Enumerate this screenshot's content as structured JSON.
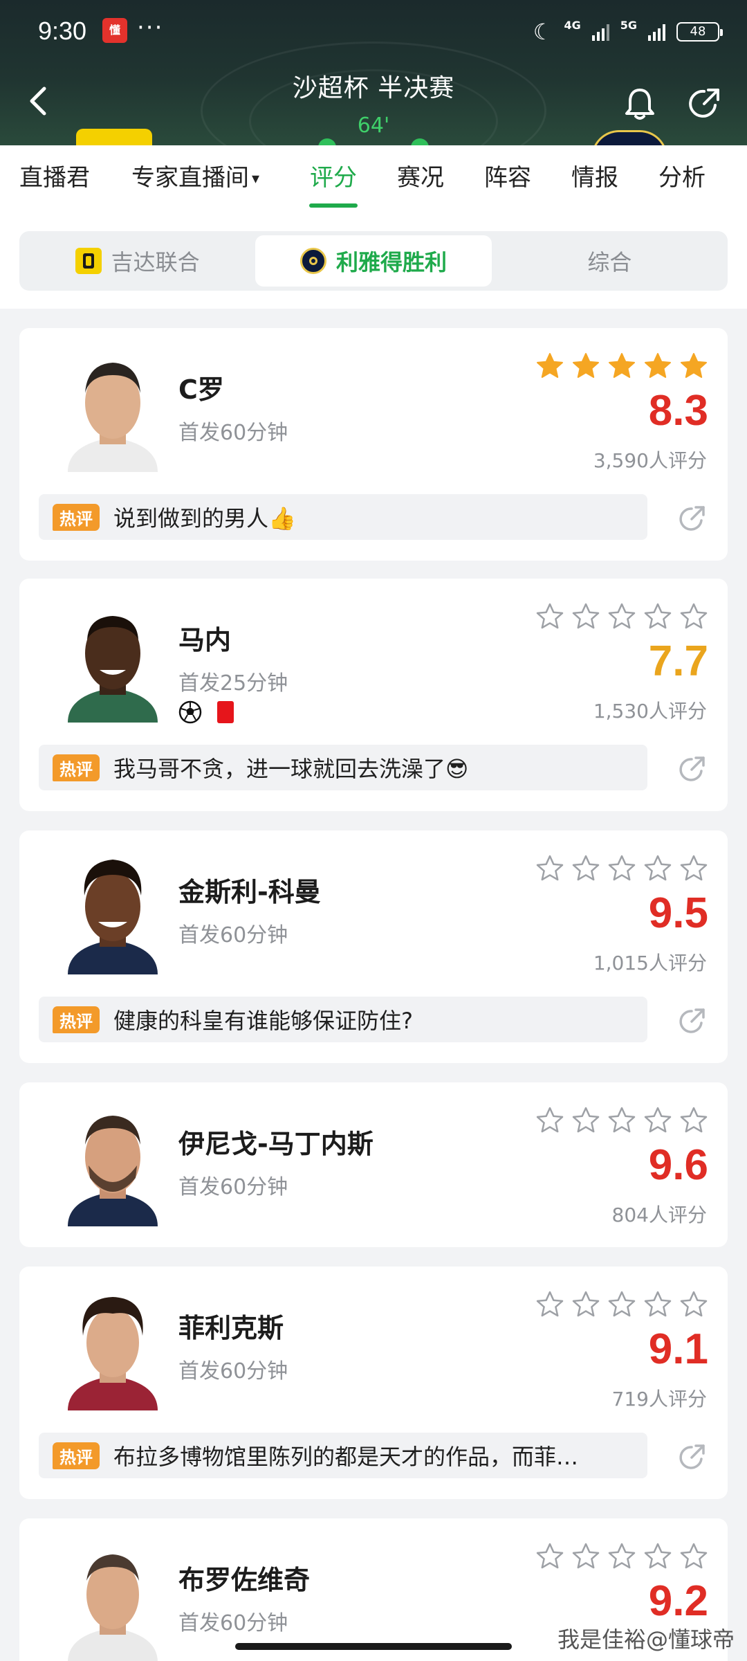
{
  "status": {
    "time": "9:30",
    "app_icon_text": "懂",
    "dots": "···",
    "net1": "4G",
    "net2": "5G",
    "battery": "48"
  },
  "header": {
    "title": "沙超杯 半决赛",
    "minute": "64'"
  },
  "tabs": [
    {
      "label": "直播君"
    },
    {
      "label": "专家直播间",
      "caret": "▾"
    },
    {
      "label": "评分",
      "active": true
    },
    {
      "label": "赛况"
    },
    {
      "label": "阵容"
    },
    {
      "label": "情报"
    },
    {
      "label": "分析"
    }
  ],
  "segment": [
    {
      "label": "吉达联合",
      "active": false
    },
    {
      "label": "利雅得胜利",
      "active": true
    },
    {
      "label": "综合",
      "active": false
    }
  ],
  "hot_label": "热评",
  "players": [
    {
      "name": "C罗",
      "sub": "首发60分钟",
      "stars_filled": 5,
      "rating": "8.3",
      "rating_color": "#e02d25",
      "votes": "3,590人评分",
      "comment": "说到做到的男人👍",
      "events": []
    },
    {
      "name": "马内",
      "sub": "首发25分钟",
      "stars_filled": 0,
      "rating": "7.7",
      "rating_color": "#eaa51d",
      "votes": "1,530人评分",
      "comment": "我马哥不贪，进一球就回去洗澡了😎",
      "events": [
        "soccer-ball",
        "red-card"
      ]
    },
    {
      "name": "金斯利-科曼",
      "sub": "首发60分钟",
      "stars_filled": 0,
      "rating": "9.5",
      "rating_color": "#e02d25",
      "votes": "1,015人评分",
      "comment": "健康的科皇有谁能够保证防住?",
      "events": []
    },
    {
      "name": "伊尼戈-马丁内斯",
      "sub": "首发60分钟",
      "stars_filled": 0,
      "rating": "9.6",
      "rating_color": "#e02d25",
      "votes": "804人评分",
      "comment": null,
      "events": []
    },
    {
      "name": "菲利克斯",
      "sub": "首发60分钟",
      "stars_filled": 0,
      "rating": "9.1",
      "rating_color": "#e02d25",
      "votes": "719人评分",
      "comment": "布拉多博物馆里陈列的都是天才的作品，而菲…",
      "events": []
    },
    {
      "name": "布罗佐维奇",
      "sub": "首发60分钟",
      "stars_filled": 0,
      "rating": "9.2",
      "rating_color": "#e02d25",
      "votes": "",
      "comment": null,
      "events": []
    }
  ],
  "watermark": "我是佳裕@懂球帝",
  "colors": {
    "accent_green": "#1faa4b",
    "rating_red": "#e02d25",
    "rating_gold": "#eaa51d",
    "star_gold": "#f5a623",
    "hot_orange": "#f39a2a"
  }
}
